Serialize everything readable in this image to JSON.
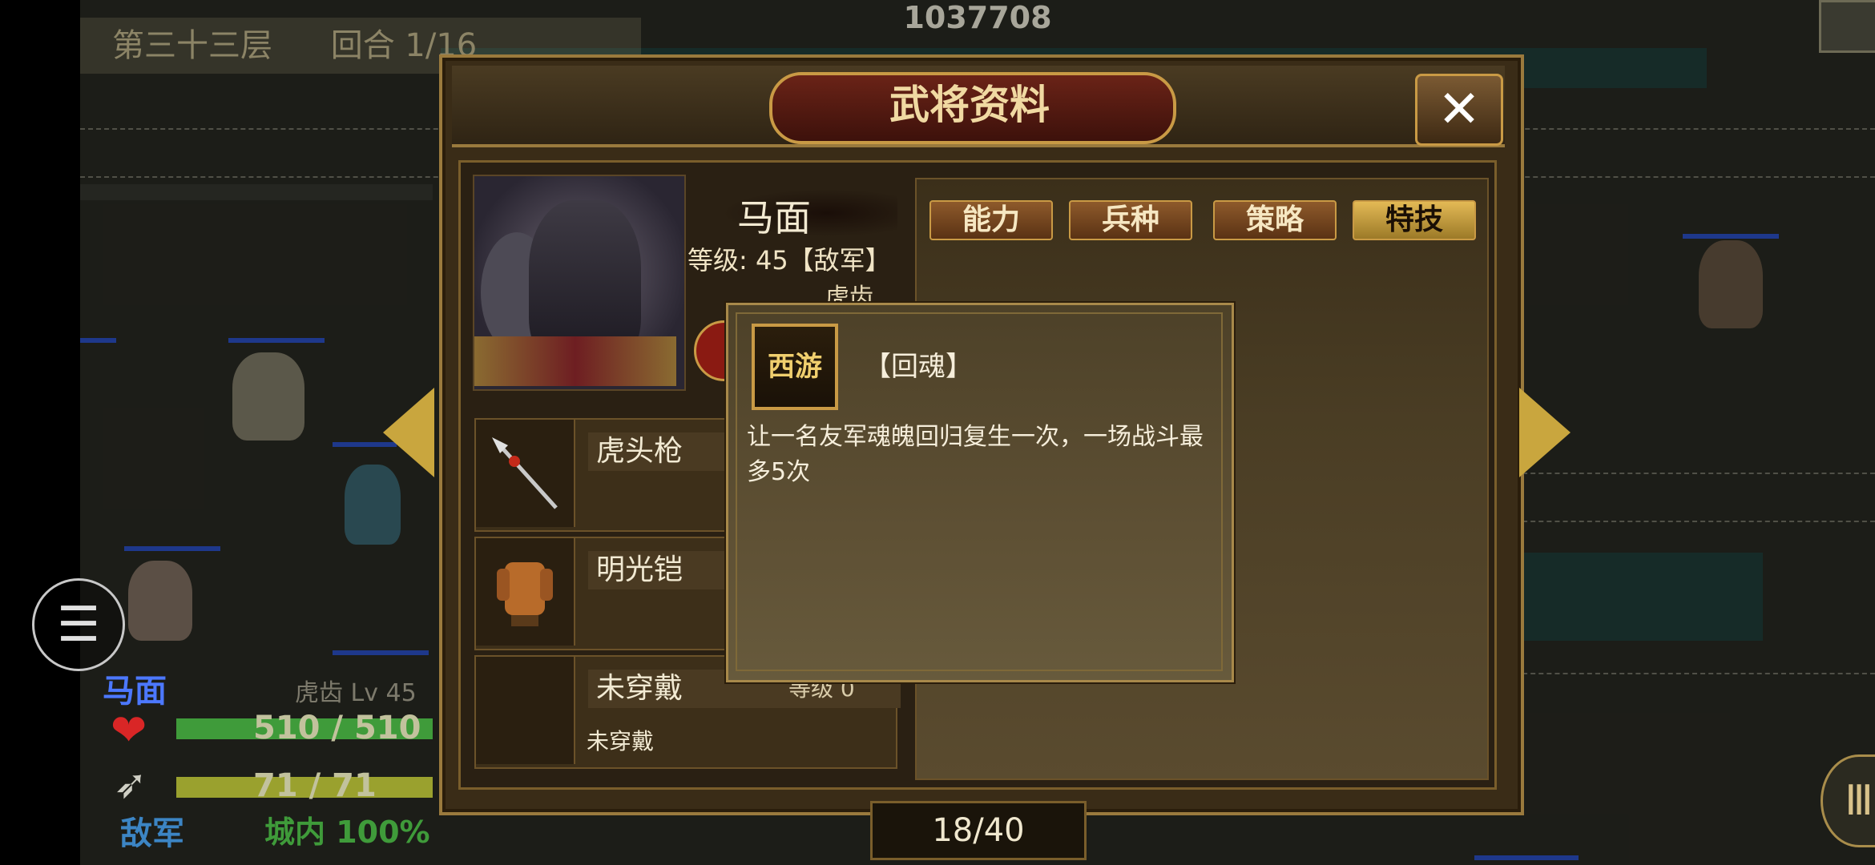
{
  "header": {
    "floor": "第三十三层",
    "round": "回合 1/16",
    "score": "1037708"
  },
  "dialog": {
    "title": "武将资料",
    "close_label": "✕"
  },
  "hero": {
    "name": "马面",
    "level_text": "等级: 45【敌军】",
    "class_text": "虎齿"
  },
  "equipment": [
    {
      "name": "虎头枪",
      "icon": "spear-icon"
    },
    {
      "name": "明光铠",
      "icon": "armor-icon"
    },
    {
      "name": "未穿戴",
      "level": "等级 0",
      "sub": "未穿戴",
      "icon": "empty-slot-icon"
    }
  ],
  "tabs": [
    {
      "label": "能力",
      "active": false
    },
    {
      "label": "兵种",
      "active": false
    },
    {
      "label": "策略",
      "active": false
    },
    {
      "label": "特技",
      "active": true
    }
  ],
  "skill_popup": {
    "badge": "西游",
    "name": "【回魂】",
    "description": "让一名友军魂魄回归复生一次，一场战斗最多5次"
  },
  "pager": {
    "text": "18/40"
  },
  "status": {
    "unit_name": "马面",
    "unit_class": "虎齿 Lv 45",
    "hp_text": "510 / 510",
    "mp_text": "71 / 71",
    "side": "敌军",
    "location": "城内 100%"
  },
  "colors": {
    "accent_gold": "#c99a45",
    "title_red": "#6a2317",
    "tab_active": "#e3b955",
    "hp_green": "#3f9b3a",
    "side_blue": "#4c78ff"
  }
}
